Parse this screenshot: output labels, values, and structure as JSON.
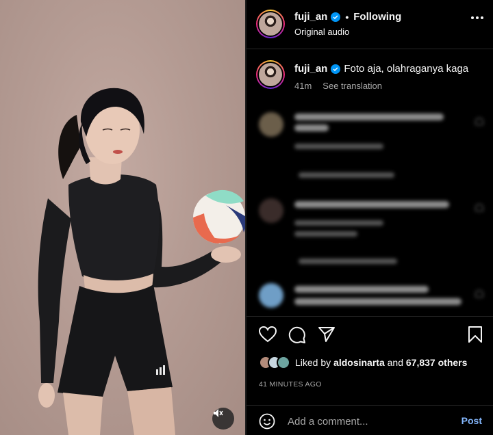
{
  "post": {
    "username": "fuji_an",
    "follow_state": "Following",
    "separator": "•",
    "audio_label": "Original audio"
  },
  "caption": {
    "username": "fuji_an",
    "text": "Foto aja, olahraganya kaga",
    "time": "41m",
    "translate_label": "See translation"
  },
  "engagement": {
    "liked_by_prefix": "Liked by",
    "liked_by_user": "aldosinarta",
    "liked_by_and": "and",
    "others_count": "67,837 others",
    "time_ago": "41 MINUTES AGO"
  },
  "comment_box": {
    "placeholder": "Add a comment...",
    "post_label": "Post"
  },
  "icons": {
    "verified": "verified-badge-icon",
    "more": "more-options-icon",
    "like": "heart-icon",
    "comment": "comment-icon",
    "share": "share-icon",
    "save": "bookmark-icon",
    "emoji": "emoji-icon",
    "mute": "sound-off-icon"
  },
  "colors": {
    "background": "#000000",
    "verified": "#0095f6",
    "post_link": "#85b8ff",
    "secondary_text": "#a8a8a8"
  }
}
